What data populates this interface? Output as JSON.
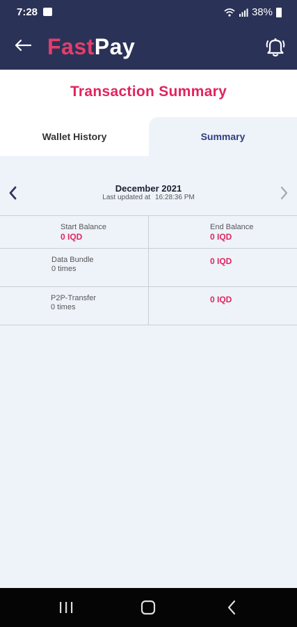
{
  "status_bar": {
    "time": "7:28",
    "battery_text": "38%"
  },
  "app_bar": {
    "logo_part1": "Fast",
    "logo_part2": "Pay"
  },
  "page": {
    "title": "Transaction Summary"
  },
  "tabs": [
    {
      "label": "Wallet History",
      "active": false
    },
    {
      "label": "Summary",
      "active": true
    }
  ],
  "month_nav": {
    "month": "December 2021",
    "updated_label": "Last updated at",
    "updated_time": "16:28:36 PM"
  },
  "summary_grid": {
    "start_balance_label": "Start Balance",
    "start_balance_value": "0 IQD",
    "end_balance_label": "End Balance",
    "end_balance_value": "0 IQD",
    "rows": [
      {
        "name": "Data Bundle",
        "times": "0 times",
        "value": "0 IQD"
      },
      {
        "name": "P2P-Transfer",
        "times": "0 times",
        "value": "0 IQD"
      }
    ]
  },
  "colors": {
    "header_bg": "#2b3258",
    "accent": "#e0245e",
    "content_bg": "#eef3fa"
  }
}
